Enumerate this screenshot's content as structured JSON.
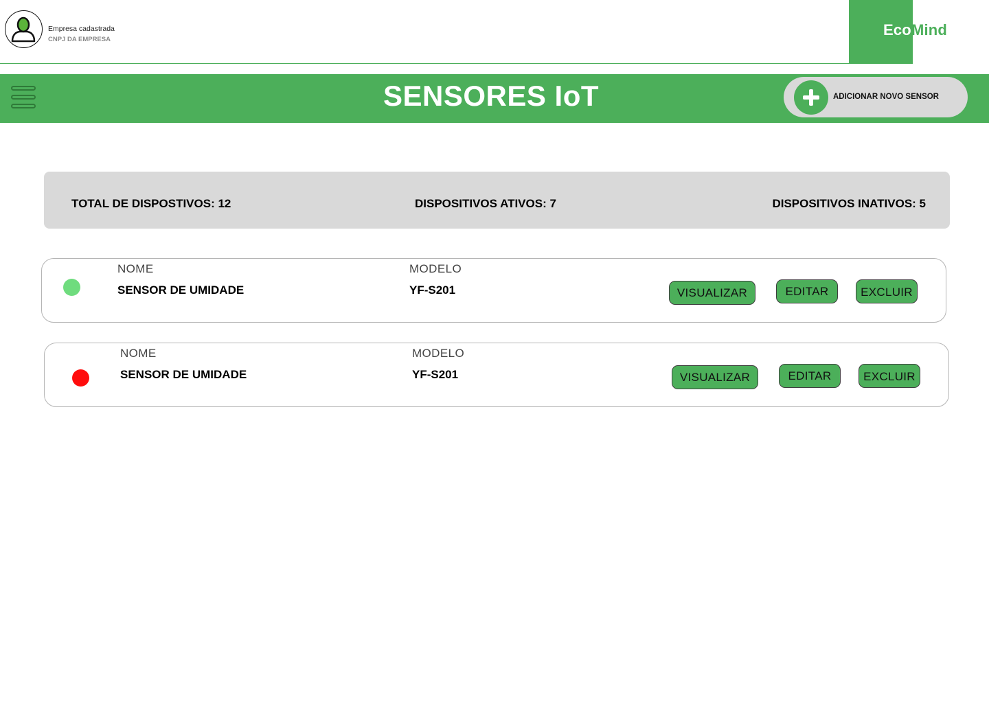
{
  "header": {
    "company_name": "Empresa cadastrada",
    "company_cnpj": "CNPJ  DA EMPRESA",
    "brand_part1": "Eco",
    "brand_part2": "Mind"
  },
  "title_bar": {
    "title": "SENSORES IoT",
    "add_button_label": "ADICIONAR NOVO SENSOR"
  },
  "summary": {
    "total": "TOTAL DE DISPOSTIVOS: 12",
    "active": "DISPOSITIVOS ATIVOS: 7",
    "inactive": "DISPOSITIVOS INATIVOS: 5"
  },
  "sensors": [
    {
      "status": "active",
      "status_color": "#6fdc7e",
      "name_label": "NOME",
      "name": "SENSOR DE UMIDADE",
      "model_label": "MODELO",
      "model": "YF-S201",
      "view_label": "VISUALIZAR",
      "edit_label": "EDITAR",
      "delete_label": "EXCLUIR"
    },
    {
      "status": "inactive",
      "status_color": "#ff0d0d",
      "name_label": "NOME",
      "name": "SENSOR DE UMIDADE",
      "model_label": "MODELO",
      "model": "YF-S201",
      "view_label": "VISUALIZAR",
      "edit_label": "EDITAR",
      "delete_label": "EXCLUIR"
    }
  ],
  "colors": {
    "primary": "#4caf5a",
    "panel": "#d9d9d9"
  },
  "icons": {
    "avatar": "user-icon",
    "menu": "hamburger-menu-icon",
    "add": "plus-icon"
  }
}
